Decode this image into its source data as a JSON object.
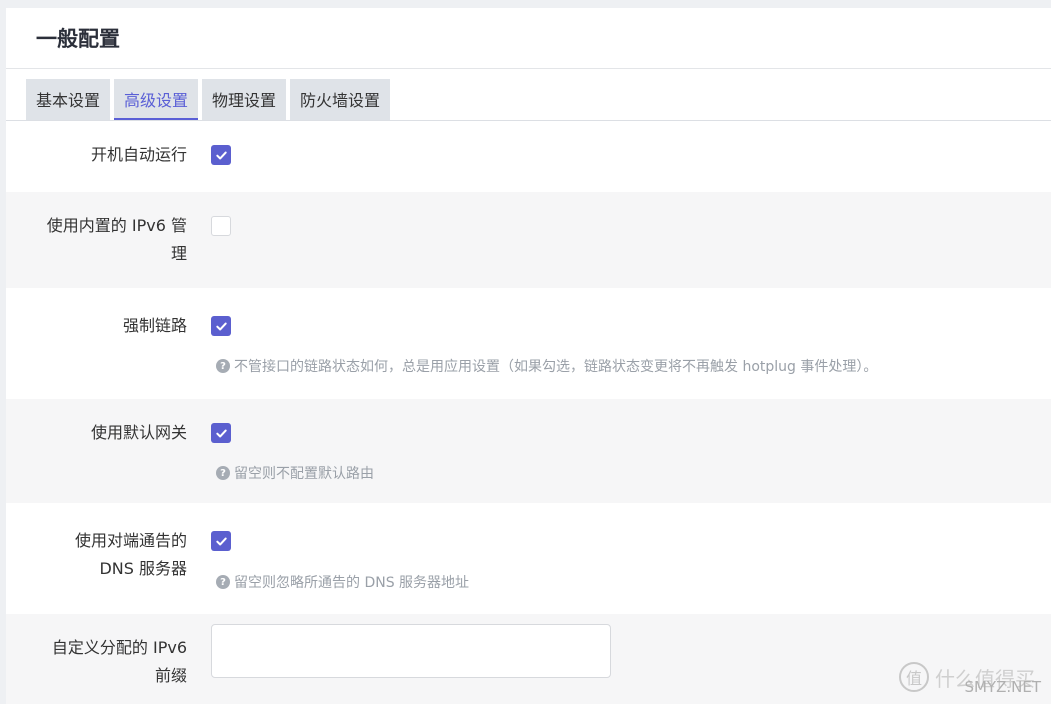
{
  "page_title": "一般配置",
  "tabs": [
    {
      "label": "基本设置",
      "active": false
    },
    {
      "label": "高级设置",
      "active": true
    },
    {
      "label": "物理设置",
      "active": false
    },
    {
      "label": "防火墙设置",
      "active": false
    }
  ],
  "fields": {
    "autostart": {
      "label": "开机自动运行",
      "checked": true
    },
    "ipv6_mgmt": {
      "label_line1": "使用内置的 IPv6 管",
      "label_line2": "理",
      "checked": false
    },
    "force_link": {
      "label": "强制链路",
      "checked": true,
      "hint": "不管接口的链路状态如何，总是用应用设置（如果勾选，链路状态变更将不再触发 hotplug 事件处理）。"
    },
    "default_gw": {
      "label": "使用默认网关",
      "checked": true,
      "hint": "留空则不配置默认路由"
    },
    "peer_dns": {
      "label_line1": "使用对端通告的",
      "label_line2": "DNS 服务器",
      "checked": true,
      "hint": "留空则忽略所通告的 DNS 服务器地址"
    },
    "ipv6_prefix": {
      "label_line1": "自定义分配的 IPv6",
      "label_line2": "前缀",
      "value": ""
    }
  },
  "watermark": {
    "glyph": "值",
    "text": "什么值得买",
    "site": "SMYZ.NET"
  },
  "colors": {
    "accent": "#5b5fcf",
    "hint": "#9aa0a8"
  }
}
